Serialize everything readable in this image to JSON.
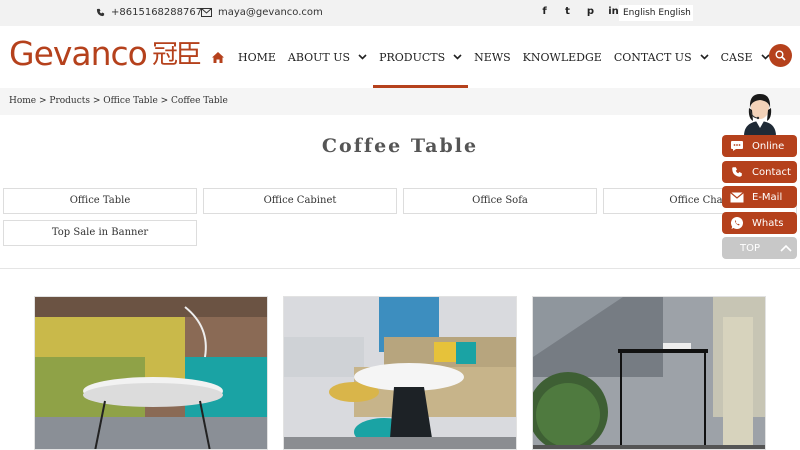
{
  "topbar": {
    "phone": "+8615168288767",
    "email": "maya@gevanco.com",
    "socials": [
      "f",
      "t",
      "p",
      "in"
    ],
    "language": "English  English"
  },
  "logo": {
    "text": "Gevanco",
    "cn": "冠臣"
  },
  "nav": {
    "items": [
      {
        "label": "HOME"
      },
      {
        "label": "ABOUT US"
      },
      {
        "label": "PRODUCTS"
      },
      {
        "label": "NEWS"
      },
      {
        "label": "KNOWLEDGE"
      },
      {
        "label": "CONTACT US"
      },
      {
        "label": "CASE"
      }
    ],
    "active": "PRODUCTS"
  },
  "breadcrumb": "Home > Products > Office Table > Coffee Table",
  "page_title": "Coffee Table",
  "categories": [
    "Office Table",
    "Office Cabinet",
    "Office Sofa",
    "Office Chair",
    "Top Sale in Banner"
  ],
  "float_widget": {
    "buttons": [
      "Online",
      "Contact",
      "E-Mail",
      "Whats"
    ],
    "top_label": "TOP"
  },
  "colors": {
    "brand": "#b5411c",
    "topbar_bg": "#f2f2f2",
    "crumb_bg": "#f5f5f5"
  }
}
